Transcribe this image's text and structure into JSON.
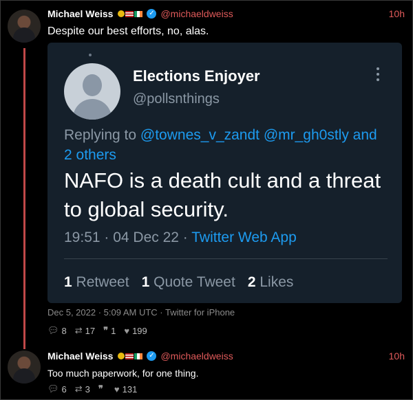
{
  "tweet1": {
    "name": "Michael Weiss",
    "handle": "@michaeldweiss",
    "time": "10h",
    "text": "Despite our best efforts, no, alas.",
    "meta": "Dec 5, 2022 · 5:09 AM UTC · Twitter for iPhone",
    "replies": "8",
    "retweets": "17",
    "quotes": "1",
    "likes": "199"
  },
  "embed": {
    "name": "Elections Enjoyer",
    "handle": "@pollsnthings",
    "replying_prefix": "Replying to ",
    "replying_links": "@townes_v_zandt @mr_gh0stly and 2 others",
    "text": "NAFO is a death cult and a threat to global security.",
    "time": "19:51 · 04 Dec 22 · ",
    "source": "Twitter Web App",
    "retweet_count": "1",
    "retweet_label": "Retweet",
    "quote_count": "1",
    "quote_label": "Quote Tweet",
    "like_count": "2",
    "like_label": "Likes"
  },
  "tweet2": {
    "name": "Michael Weiss",
    "handle": "@michaeldweiss",
    "time": "10h",
    "text": "Too much paperwork, for one thing.",
    "replies": "6",
    "retweets": "3",
    "quotes": "",
    "likes": "131"
  },
  "colors": {
    "accent_red": "#e05a5a",
    "twitter_blue": "#1d9bf0",
    "card_bg": "#15202b"
  }
}
